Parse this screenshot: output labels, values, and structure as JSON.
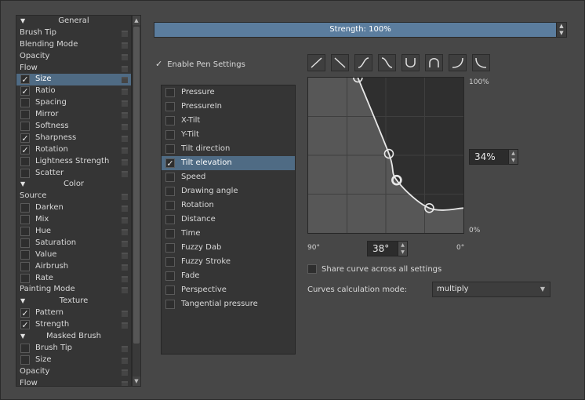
{
  "left_list": {
    "rows": [
      {
        "kind": "header",
        "label": "General"
      },
      {
        "kind": "plain",
        "label": "Brush Tip",
        "lock": true
      },
      {
        "kind": "plain",
        "label": "Blending Mode",
        "lock": true
      },
      {
        "kind": "plain",
        "label": "Opacity",
        "lock": true
      },
      {
        "kind": "plain",
        "label": "Flow",
        "lock": true
      },
      {
        "kind": "check",
        "label": "Size",
        "checked": true,
        "selected": true,
        "lock": true
      },
      {
        "kind": "check",
        "label": "Ratio",
        "checked": true,
        "lock": true
      },
      {
        "kind": "check",
        "label": "Spacing",
        "checked": false,
        "lock": true
      },
      {
        "kind": "check",
        "label": "Mirror",
        "checked": false,
        "lock": true
      },
      {
        "kind": "check",
        "label": "Softness",
        "checked": false,
        "lock": true
      },
      {
        "kind": "check",
        "label": "Sharpness",
        "checked": true,
        "lock": true
      },
      {
        "kind": "check",
        "label": "Rotation",
        "checked": true,
        "lock": true
      },
      {
        "kind": "check",
        "label": "Lightness Strength",
        "checked": false,
        "lock": true
      },
      {
        "kind": "check",
        "label": "Scatter",
        "checked": false,
        "lock": true
      },
      {
        "kind": "header",
        "label": "Color"
      },
      {
        "kind": "plain",
        "label": "Source",
        "lock": true
      },
      {
        "kind": "check",
        "label": "Darken",
        "checked": false,
        "lock": true
      },
      {
        "kind": "check",
        "label": "Mix",
        "checked": false,
        "lock": true
      },
      {
        "kind": "check",
        "label": "Hue",
        "checked": false,
        "lock": true
      },
      {
        "kind": "check",
        "label": "Saturation",
        "checked": false,
        "lock": true
      },
      {
        "kind": "check",
        "label": "Value",
        "checked": false,
        "lock": true
      },
      {
        "kind": "check",
        "label": "Airbrush",
        "checked": false,
        "lock": true
      },
      {
        "kind": "check",
        "label": "Rate",
        "checked": false,
        "lock": true
      },
      {
        "kind": "plain",
        "label": "Painting Mode",
        "lock": true
      },
      {
        "kind": "header",
        "label": "Texture"
      },
      {
        "kind": "check",
        "label": "Pattern",
        "checked": true,
        "lock": true
      },
      {
        "kind": "check",
        "label": "Strength",
        "checked": true,
        "lock": true
      },
      {
        "kind": "header",
        "label": "Masked Brush"
      },
      {
        "kind": "check",
        "label": "Brush Tip",
        "checked": false,
        "lock": true
      },
      {
        "kind": "check",
        "label": "Size",
        "checked": false,
        "lock": true
      },
      {
        "kind": "plain",
        "label": "Opacity",
        "lock": true
      },
      {
        "kind": "plain",
        "label": "Flow",
        "lock": true
      }
    ]
  },
  "strength_slider": {
    "label": "Strength: 100%"
  },
  "enable_pen_settings": {
    "label": "Enable Pen Settings",
    "checked": true
  },
  "sensors": [
    {
      "label": "Pressure",
      "checked": false
    },
    {
      "label": "PressureIn",
      "checked": false
    },
    {
      "label": "X-Tilt",
      "checked": false
    },
    {
      "label": "Y-Tilt",
      "checked": false
    },
    {
      "label": "Tilt direction",
      "checked": false
    },
    {
      "label": "Tilt elevation",
      "checked": true,
      "selected": true
    },
    {
      "label": "Speed",
      "checked": false
    },
    {
      "label": "Drawing angle",
      "checked": false
    },
    {
      "label": "Rotation",
      "checked": false
    },
    {
      "label": "Distance",
      "checked": false
    },
    {
      "label": "Time",
      "checked": false
    },
    {
      "label": "Fuzzy Dab",
      "checked": false
    },
    {
      "label": "Fuzzy Stroke",
      "checked": false
    },
    {
      "label": "Fade",
      "checked": false
    },
    {
      "label": "Perspective",
      "checked": false
    },
    {
      "label": "Tangential pressure",
      "checked": false
    }
  ],
  "curve_presets": [
    {
      "name": "linear-up-icon"
    },
    {
      "name": "linear-down-icon"
    },
    {
      "name": "s-curve-up-icon"
    },
    {
      "name": "s-curve-down-icon"
    },
    {
      "name": "u-curve-icon"
    },
    {
      "name": "arch-curve-icon"
    },
    {
      "name": "ease-in-icon"
    },
    {
      "name": "ease-out-icon"
    }
  ],
  "curve": {
    "y_max_label": "100%",
    "y_min_label": "0%",
    "x_left_label": "90°",
    "x_right_label": "0°",
    "points": [
      [
        0.32,
        1.0
      ],
      [
        0.52,
        0.51
      ],
      [
        0.57,
        0.34
      ],
      [
        0.78,
        0.16
      ],
      [
        1.0,
        0.16
      ]
    ]
  },
  "value_spin": {
    "value": "34%"
  },
  "angle_spin": {
    "value": "38°"
  },
  "share_curve": {
    "label": "Share curve across all settings",
    "checked": false
  },
  "curves_mode": {
    "label": "Curves calculation mode:",
    "value": "multiply"
  },
  "colors": {
    "accent": "#5b7d9e",
    "selection": "#4f6b84"
  }
}
